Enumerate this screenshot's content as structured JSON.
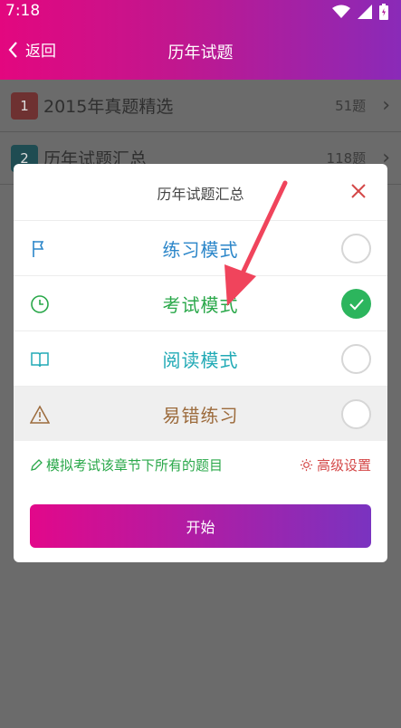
{
  "status_bar": {
    "time": "7:18"
  },
  "title_bar": {
    "back_label": "返回",
    "title": "历年试题"
  },
  "list": [
    {
      "num": "1",
      "label": "2015年真题精选",
      "count": "51题",
      "num_color": "#a83a3a"
    },
    {
      "num": "2",
      "label": "历年试题汇总",
      "count": "118题",
      "num_color": "#1e6f7a"
    }
  ],
  "dialog": {
    "title": "历年试题汇总",
    "modes": [
      {
        "label": "练习模式",
        "icon": "flag-icon",
        "color": "#2b86c9",
        "selected": false
      },
      {
        "label": "考试模式",
        "icon": "clock-icon",
        "color": "#2aa84a",
        "selected": true
      },
      {
        "label": "阅读模式",
        "icon": "book-icon",
        "color": "#22aab6",
        "selected": false
      },
      {
        "label": "易错练习",
        "icon": "warning-icon",
        "color": "#9c6b3c",
        "selected": false
      }
    ],
    "hint": "模拟考试该章节下所有的题目",
    "advanced_settings": "高级设置",
    "start_button": "开始"
  },
  "colors": {
    "header_gradient": [
      "#e3077f",
      "#8a2ab8"
    ],
    "selected": "#2cb55d",
    "arrow": "#f0445c"
  }
}
